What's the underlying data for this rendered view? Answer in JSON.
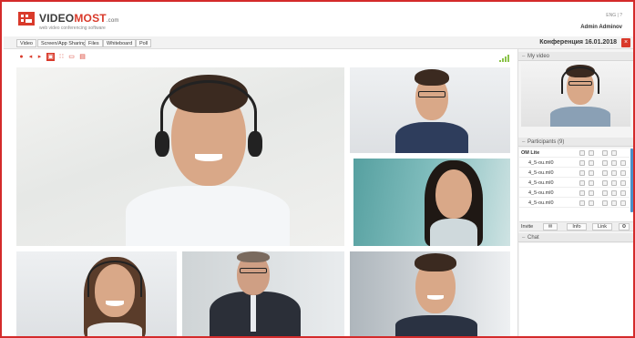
{
  "header": {
    "logo_main": "VIDEO",
    "logo_accent": "MOST",
    "logo_suffix": ".com",
    "logo_tagline": "web video conferencing software",
    "user_name": "Admin Adminov",
    "top_icons": "ENG | ?"
  },
  "tabs": [
    {
      "label": "Video"
    },
    {
      "label": "Screen/App Sharing"
    },
    {
      "label": "Files"
    },
    {
      "label": "Whiteboard"
    },
    {
      "label": "Poll"
    }
  ],
  "conference": {
    "title": "Конференция 16.01.2018",
    "close_icon": "close-icon"
  },
  "toolbar": {
    "icons": [
      "microphone-icon",
      "speaker-icon",
      "camera-icon",
      "layout-active-icon",
      "grid-icon",
      "fullscreen-icon",
      "record-icon"
    ],
    "signal_icon": "signal-strength-icon"
  },
  "side": {
    "my_video_header": "My video",
    "participants_header": "Participants (9)",
    "participants": [
      {
        "name": "OM Lite"
      },
      {
        "name": "4_5-ou.ml0"
      },
      {
        "name": "4_5-ou.ml0"
      },
      {
        "name": "4_5-ou.ml0"
      },
      {
        "name": "4_5-ou.ml0"
      },
      {
        "name": "4_5-ou.ml0"
      }
    ],
    "invite_label": "Invite",
    "info_button": "Info",
    "link_button": "Link",
    "chat_header": "Chat"
  },
  "colors": {
    "accent": "#d93a2b",
    "scroll": "#4a8fc7",
    "signal": "#8bc34a"
  }
}
